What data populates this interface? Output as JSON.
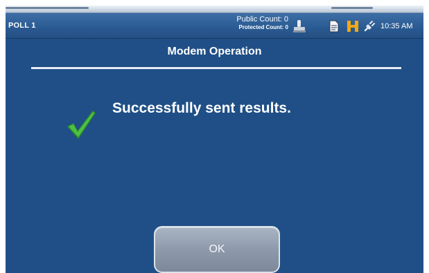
{
  "status_bar": {
    "poll": "POLL 1",
    "public_count": "Public Count: 0",
    "protected_count": "Protected Count: 0",
    "time": "10:35 AM",
    "icons": [
      "ballot-stamp-icon",
      "document-icon",
      "h-icon",
      "power-plug-icon"
    ]
  },
  "dialog": {
    "title": "Modem Operation",
    "message": "Successfully sent results.",
    "status_icon": "checkmark-icon",
    "ok_label": "OK"
  },
  "colors": {
    "background": "#1f4f86",
    "status_bar": "#2a5a92",
    "checkmark": "#3aa832",
    "h_icon": "#f2a813",
    "button": "#8e9aab"
  }
}
